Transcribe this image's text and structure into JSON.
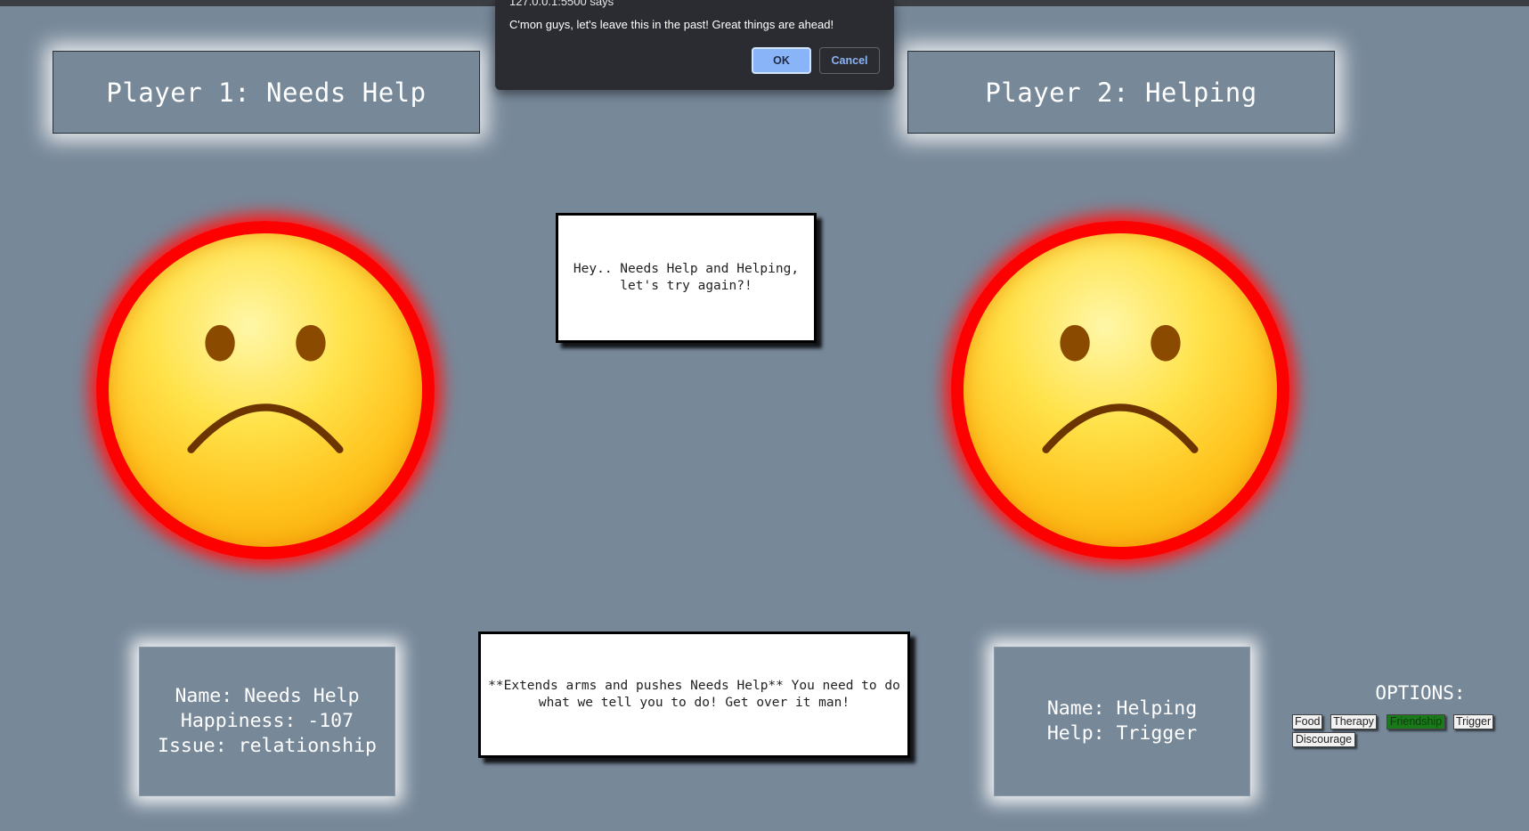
{
  "player1": {
    "title": "Player 1: Needs Help"
  },
  "player2": {
    "title": "Player 2: Helping"
  },
  "message_top": "Hey.. Needs Help and Helping, let's try again?!",
  "message_bottom": "**Extends arms and pushes Needs Help** You need to do what we tell you to do! Get over it man!",
  "info1": {
    "name": "Name: Needs Help",
    "happiness": "Happiness: -107",
    "issue": "Issue: relationship"
  },
  "info2": {
    "name": "Name: Helping",
    "help": "Help: Trigger"
  },
  "options": {
    "title": "OPTIONS:",
    "food": "Food",
    "therapy": "Therapy",
    "friendship": "Friendship",
    "trigger": "Trigger",
    "discourage": "Discourage",
    "selected_color": "#1a7a1a"
  },
  "dialog": {
    "origin": "127.0.0.1:5500 says",
    "message": "C'mon guys, let's leave this in the past! Great things are ahead!",
    "ok": "OK",
    "cancel": "Cancel"
  },
  "faces": {
    "icon": "sad-face-icon",
    "ring_color": "#ff0000"
  }
}
